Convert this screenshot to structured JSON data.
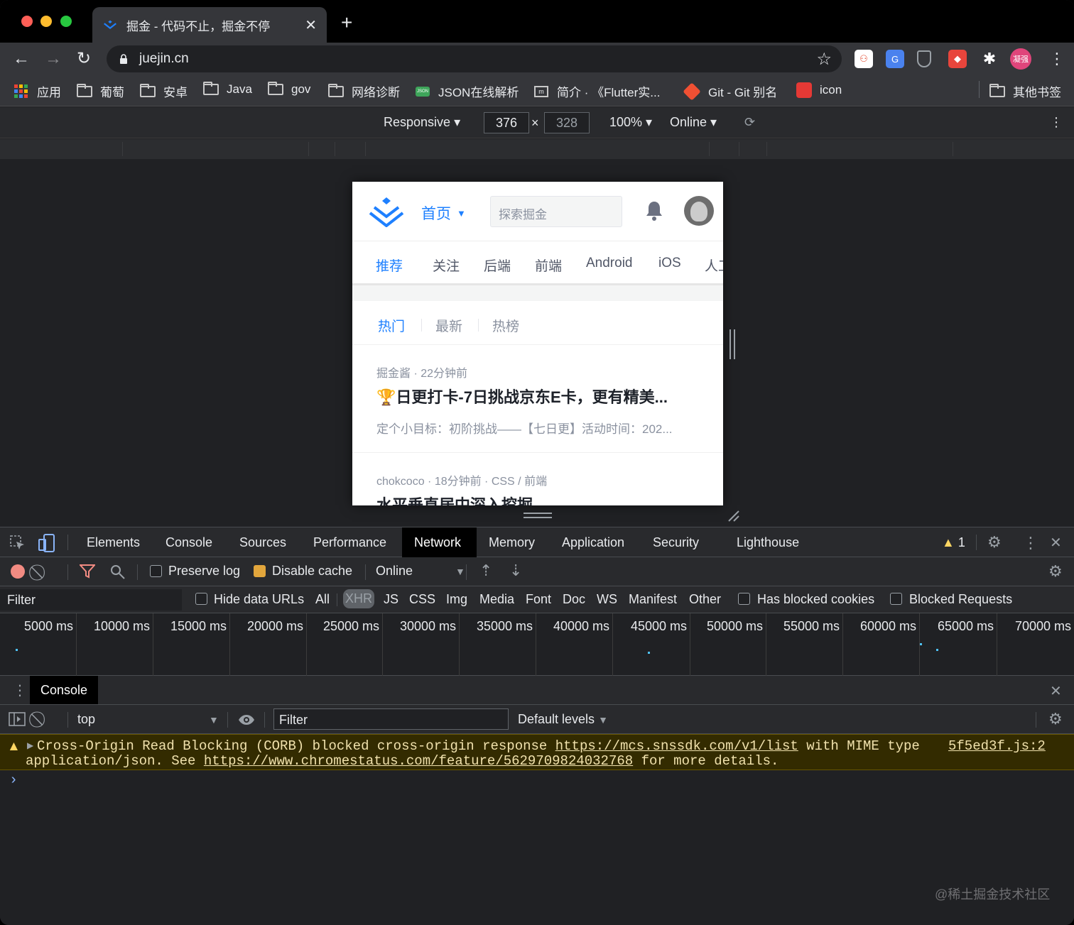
{
  "browser": {
    "tab_title": "掘金 - 代码不止，掘金不停",
    "url": "juejin.cn",
    "profile_badge": "凝强",
    "bookmarks": [
      "应用",
      "葡萄",
      "安卓",
      "Java",
      "gov",
      "网络诊断",
      "JSON在线解析",
      "简介 · 《Flutter实...",
      "Git - Git 别名",
      "icon",
      "其他书签"
    ]
  },
  "device_toolbar": {
    "mode": "Responsive",
    "width": "376",
    "times": "×",
    "height": "328",
    "zoom": "100%",
    "throttle": "Online"
  },
  "page": {
    "home_label": "首页",
    "search_placeholder": "探索掘金",
    "nav_tabs": [
      "推荐",
      "关注",
      "后端",
      "前端",
      "Android",
      "iOS",
      "人工"
    ],
    "sub_tabs": [
      "热门",
      "最新",
      "热榜"
    ],
    "articles": [
      {
        "meta": "掘金酱 · 22分钟前",
        "title": "🏆日更打卡-7日挑战京东E卡，更有精美...",
        "desc": "定个小目标：初阶挑战——【七日更】活动时间：202..."
      },
      {
        "meta": "chokcoco · 18分钟前 · CSS / 前端",
        "title": "水平垂直居中深入挖掘",
        "desc": ""
      }
    ]
  },
  "devtools": {
    "tabs": [
      "Elements",
      "Console",
      "Sources",
      "Performance",
      "Network",
      "Memory",
      "Application",
      "Security",
      "Lighthouse"
    ],
    "active_tab": "Network",
    "warning_count": "1",
    "network_toolbar": {
      "preserve_log": "Preserve log",
      "disable_cache": "Disable cache",
      "throttle": "Online"
    },
    "filter_bar": {
      "filter_placeholder": "Filter",
      "hide_data_urls": "Hide data URLs",
      "types": [
        "All",
        "XHR",
        "JS",
        "CSS",
        "Img",
        "Media",
        "Font",
        "Doc",
        "WS",
        "Manifest",
        "Other"
      ],
      "has_blocked_cookies": "Has blocked cookies",
      "blocked_requests": "Blocked Requests"
    },
    "timeline_ticks": [
      "5000 ms",
      "10000 ms",
      "15000 ms",
      "20000 ms",
      "25000 ms",
      "30000 ms",
      "35000 ms",
      "40000 ms",
      "45000 ms",
      "50000 ms",
      "55000 ms",
      "60000 ms",
      "65000 ms",
      "70000 ms"
    ],
    "drawer": {
      "tab": "Console",
      "context": "top",
      "filter_placeholder": "Filter",
      "levels": "Default levels",
      "warning": {
        "text1": "Cross-Origin Read Blocking (CORB) blocked cross-origin response",
        "link1": "https://mcs.snssdk.com/v1/list",
        "text2": "with MIME type",
        "text3": "application/json. See",
        "link2": "https://www.chromestatus.com/feature/5629709824032768",
        "text4": "for more details.",
        "source": "5f5ed3f.js:2"
      },
      "prompt": "›"
    }
  },
  "watermark": "@稀土掘金技术社区",
  "colors": {
    "accent": "#1e80ff",
    "warn_bg": "#332b00",
    "record": "#f28b82"
  }
}
